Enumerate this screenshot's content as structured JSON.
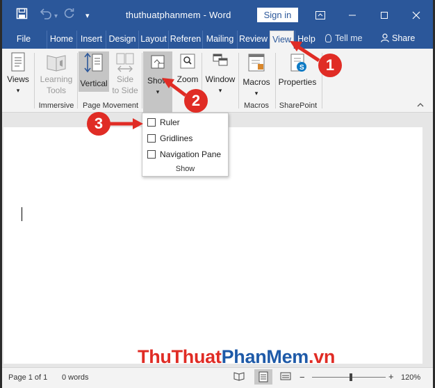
{
  "titlebar": {
    "doc_title": "thuthuatphanmem  -  Word",
    "signin_label": "Sign in",
    "save_icon": "save-icon",
    "undo_icon": "undo-icon",
    "redo_icon": "redo-icon"
  },
  "tabs": [
    {
      "label": "File"
    },
    {
      "label": "Home"
    },
    {
      "label": "Insert"
    },
    {
      "label": "Design"
    },
    {
      "label": "Layout"
    },
    {
      "label": "Referen"
    },
    {
      "label": "Mailing"
    },
    {
      "label": "Review"
    },
    {
      "label": "View"
    },
    {
      "label": "Help"
    }
  ],
  "tellme": "Tell me",
  "share": "Share",
  "ribbon": {
    "views": "Views",
    "learning_tools_1": "Learning",
    "learning_tools_2": "Tools",
    "vertical": "Vertical",
    "side_1": "Side",
    "side_2": "to Side",
    "show": "Show",
    "zoom": "Zoom",
    "window": "Window",
    "macros": "Macros",
    "properties": "Properties",
    "group_immersive": "Immersive",
    "group_page_movement": "Page Movement",
    "group_macros": "Macros",
    "group_sharepoint": "SharePoint"
  },
  "dropdown": {
    "items": [
      {
        "label": "Ruler",
        "checked": false
      },
      {
        "label": "Gridlines",
        "checked": false
      },
      {
        "label": "Navigation Pane",
        "checked": false
      }
    ],
    "group": "Show"
  },
  "statusbar": {
    "page": "Page 1 of 1",
    "words": "0 words",
    "zoom": "120%",
    "zoom_level": 1.2
  },
  "annotations": [
    "1",
    "2",
    "3"
  ],
  "watermark": {
    "part1": "ThuThuat",
    "part2": "PhanMem",
    "part3": ".vn"
  },
  "colors": {
    "accent": "#2b579a",
    "annotation": "#e02c25"
  }
}
